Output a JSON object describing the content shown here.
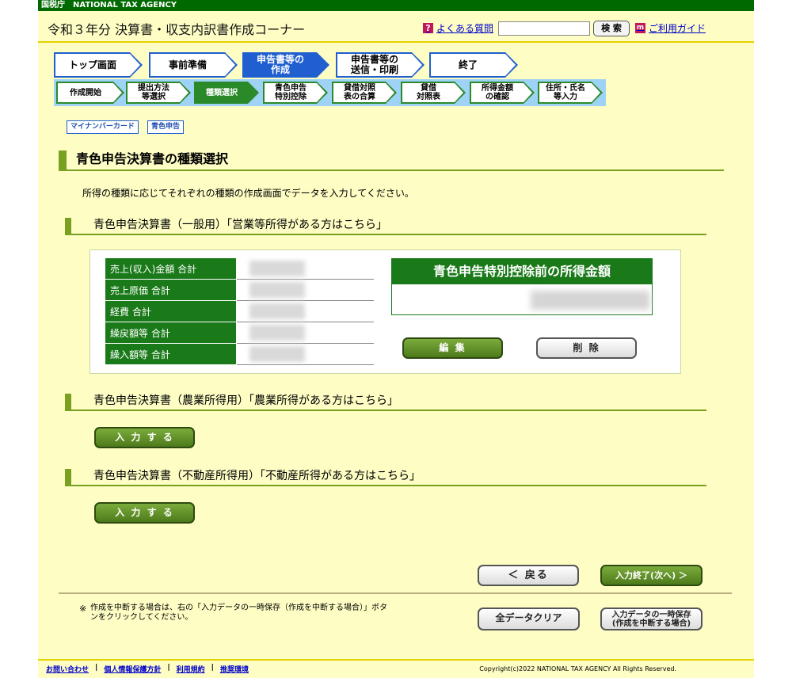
{
  "agency": "国税庁　NATIONAL TAX AGENCY",
  "header": {
    "title": "令和３年分 決算書・収支内訳書作成コーナー",
    "faq_label": "よくある質問",
    "search_value": "",
    "search_button": "検 索",
    "guide_label": "ご利用ガイド"
  },
  "steps_main": [
    {
      "label": "トップ画面"
    },
    {
      "label": "事前準備"
    },
    {
      "label": "申告書等の\n作成",
      "active": true
    },
    {
      "label": "申告書等の\n送信・印刷"
    },
    {
      "label": "終了"
    }
  ],
  "steps_sub": [
    {
      "label": "作成開始"
    },
    {
      "label": "提出方法\n等選択"
    },
    {
      "label": "種類選択",
      "active": true
    },
    {
      "label": "青色申告\n特別控除"
    },
    {
      "label": "貸借対照\n表の合算"
    },
    {
      "label": "貸借\n対照表"
    },
    {
      "label": "所得金額\nの確認"
    },
    {
      "label": "住所・氏名\n等入力"
    }
  ],
  "tags": {
    "mynumber": "マイナンバーカード",
    "blue": "青色申告"
  },
  "page_title": "青色申告決算書の種類選択",
  "description": "所得の種類に応じてそれぞれの種類の作成画面でデータを入力してください。",
  "sections": {
    "general": {
      "heading": "青色申告決算書（一般用）「営業等所得がある方はこちら」",
      "rows": [
        {
          "label": "売上(収入)金額 合計"
        },
        {
          "label": "売上原価 合計"
        },
        {
          "label": "経費 合計"
        },
        {
          "label": "繰戻額等 合計"
        },
        {
          "label": "繰入額等 合計"
        }
      ],
      "income_title": "青色申告特別控除前の所得金額",
      "edit_button": "編 集",
      "delete_button": "削 除"
    },
    "agri": {
      "heading": "青色申告決算書（農業所得用）「農業所得がある方はこちら」",
      "input_button": "入 力 す る"
    },
    "realestate": {
      "heading": "青色申告決算書（不動産所得用）「不動産所得がある方はこちら」",
      "input_button": "入 力 す る"
    }
  },
  "nav": {
    "back_button": "＜ 戻る",
    "next_button": "入力終了(次へ) ＞",
    "clear_button": "全データクリア",
    "save_button_line1": "入力データの一時保存",
    "save_button_line2": "(作成を中断する場合)"
  },
  "note_mark": "※",
  "note": "作成を中断する場合は、右の「入力データの一時保存（作成を中断する場合）」ボタンをクリックしてください。",
  "footer": {
    "links": [
      "お問い合わせ",
      "個人情報保護方針",
      "利用規約",
      "推奨環境"
    ],
    "copyright": "Copyright(c)2022 NATIONAL TAX AGENCY All Rights Reserved."
  }
}
